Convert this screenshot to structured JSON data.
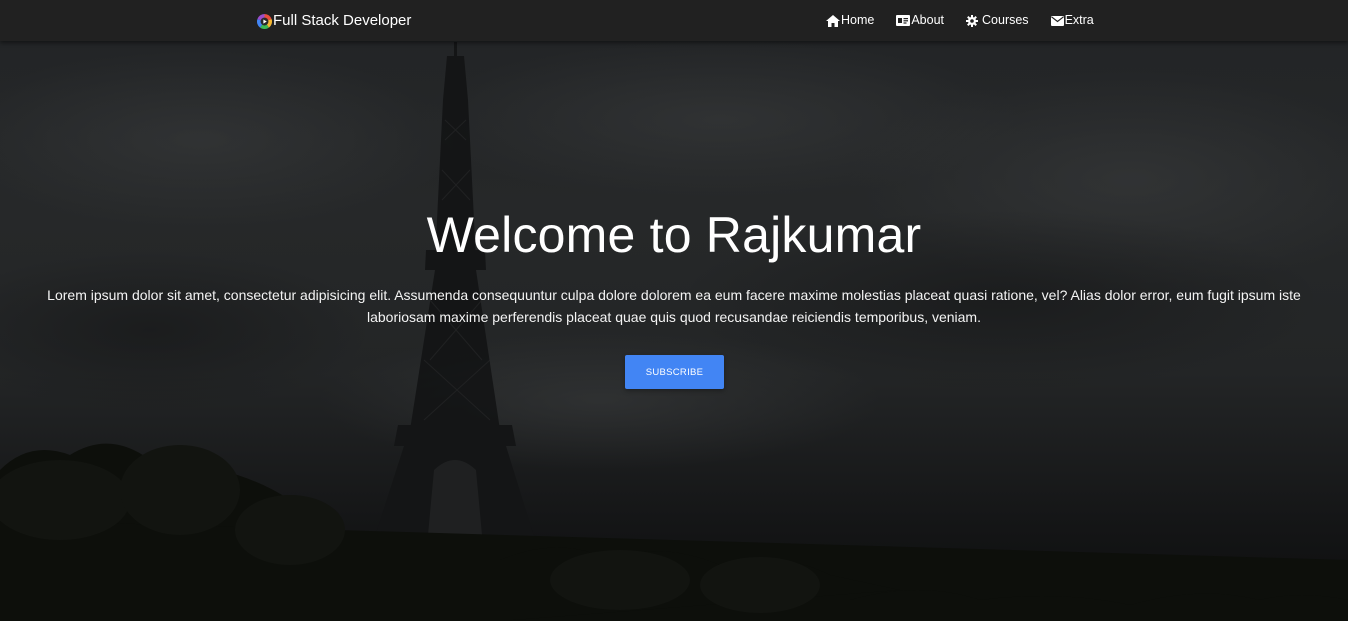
{
  "navbar": {
    "brand": "Full Stack Developer",
    "brand_icon": "multicolor-circle-play-logo-icon",
    "links": [
      {
        "label": "Home",
        "icon": "home-icon"
      },
      {
        "label": "About",
        "icon": "id-card-icon"
      },
      {
        "label": "Courses",
        "icon": "gear-icon"
      },
      {
        "label": "Extra",
        "icon": "envelope-icon"
      }
    ]
  },
  "hero": {
    "title": "Welcome to Rajkumar",
    "paragraph": "Lorem ipsum dolor sit amet, consectetur adipisicing elit. Assumenda consequuntur culpa dolore dolorem ea eum facere maxime molestias placeat quasi ratione, vel? Alias dolor error, eum fugit ipsum iste laboriosam maxime perferendis placeat quae quis quod recusandae reiciendis temporibus, veniam.",
    "button_label": "SUBSCRIBE",
    "background": "eiffel-tower-dusk-photo"
  },
  "colors": {
    "navbar": "#212121",
    "button": "#4285f4",
    "text": "#ffffff"
  }
}
